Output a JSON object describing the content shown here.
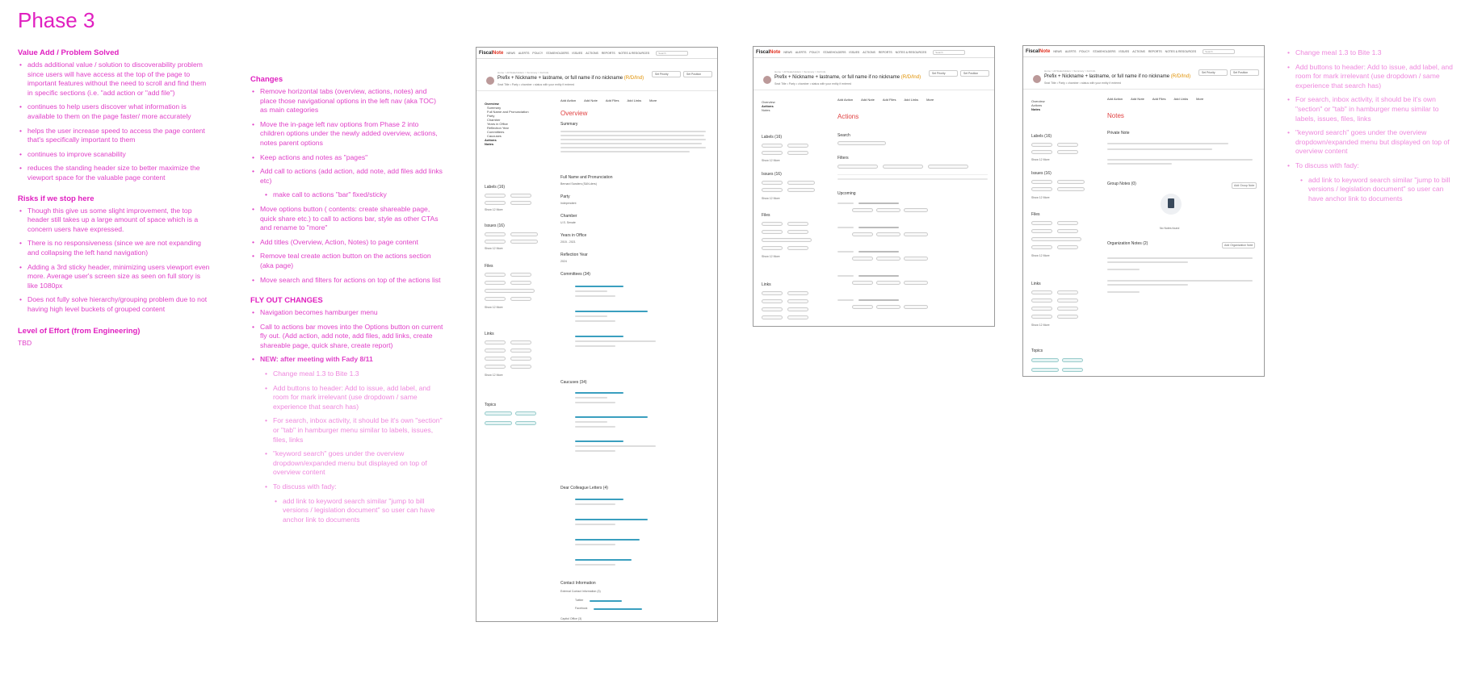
{
  "page_title": "Phase 3",
  "left_column": {
    "value_heading": "Value Add / Problem Solved",
    "value_items": [
      "adds additional value / solution to discoverability problem since users will have access at the top of the page to important features without the need to scroll and find them in specific sections (i.e. \"add action or \"add file\")",
      "continues to help users discover what information is available to them on the page faster/ more accurately",
      "helps the user increase speed to access the page content that's specifically important to them",
      "continues to improve scanability",
      "reduces the standing header size to better maximize the viewport space for the valuable page content"
    ],
    "risks_heading": "Risks if we stop here",
    "risk_items": [
      "Though this give us some slight improvement, the top header still takes up a large amount of space which is a concern users have expressed.",
      "There is no responsiveness (since we are not expanding and collapsing the left hand navigation)",
      "Adding a 3rd sticky header, minimizing users viewport even more. Average user's screen size as seen on full story is like 1080px",
      "Does not fully solve hierarchy/grouping problem due to not having high level buckets of grouped content"
    ],
    "effort_heading": "Level of Effort (from Engineering)",
    "effort_value": "TBD"
  },
  "changes_column": {
    "heading": "Changes",
    "items": [
      "Remove horizontal tabs (overview, actions, notes) and place those navigational options in the left nav (aka TOC) as main categories",
      "Move the in-page left nav options from Phase 2 into children options under the newly added overview, actions, notes parent options",
      "Keep actions and notes as \"pages\"",
      "Add call to actions (add action, add note, add files add links etc)"
    ],
    "sub_item": "make call to actions \"bar\" fixed/sticky",
    "items2": [
      "Move options button ( contents: create shareable page, quick share etc.) to call to actions bar, style as other CTAs and rename to \"more\"",
      "Add titles (Overview, Action, Notes) to page content",
      "Remove teal create action button on the actions section (aka page)",
      "Move search and filters for actions on top of the actions list"
    ],
    "flyout_heading": "FLY OUT CHANGES",
    "flyout_items": [
      "Navigation becomes hamburger menu",
      "Call to actions bar moves into the Options button on current fly out. (Add action, add note, add files, add links, create shareable page, quick share, create report)",
      "NEW: after meeting with Fady 8/11"
    ],
    "new_items": [
      "Change meal 1.3 to Bite 1.3",
      "Add buttons to header: Add to issue, add label, and room for mark irrelevant (use dropdown / same experience that search has)",
      "For search, inbox activity, it should be it's own \"section\" or \"tab\" in hamburger menu similar to labels, issues, files, links",
      "\"keyword search\" goes under the overview dropdown/expanded menu but displayed on top of overview content",
      "To discuss with fady:"
    ],
    "discuss_item": "add link to keyword search similar \"jump to bill versions / legislation document\" so user can have anchor link to documents"
  },
  "right_column": {
    "items": [
      "Change meal 1.3 to Bite 1.3",
      "Add buttons to header: Add to issue, add label, and room for mark irrelevant (use dropdown / same experience that search has)",
      "For search, inbox activity, it should be it's own \"section\" or \"tab\" in hamburger menu similar to labels, issues, files, links",
      "\"keyword search\" goes under the overview dropdown/expanded menu but displayed on top of overview content",
      "To discuss with fady:"
    ],
    "discuss_item": "add link to keyword search similar \"jump to bill versions / legislation document\" so user can have anchor link to documents"
  },
  "mock": {
    "logo_a": "Fiscal",
    "logo_b": "Note",
    "nav_items": [
      "NEWS",
      "ALERTS",
      "POLICY",
      "STAKEHOLDERS",
      "ISSUES",
      "ACTIONS",
      "REPORTS",
      "NOTES & RESOURCES"
    ],
    "search_placeholder": "Search",
    "breadcrumb": "Home > All Stakeholders > Summary > Full Info",
    "header_name": "Prefix + Nickname + lastname, or full name if no nickname",
    "header_party": "(R/D/Ind)",
    "header_sub": "Seat Title • Party • chamber • status with your entity if entered",
    "set_priority": "Set Priority",
    "set_position": "Set Position",
    "actions_bar": [
      "Add Action",
      "Add Note",
      "Add Files",
      "Add Links",
      "More"
    ],
    "toc_overview": [
      "Overview",
      "Summary",
      "Full Name and Pronunciation",
      "Party",
      "Chamber",
      "Years in Office",
      "Reflection Year",
      "Committees",
      "Caucuses",
      "Actions",
      "Notes"
    ],
    "toc_short": [
      "Overview",
      "Actions",
      "Notes"
    ],
    "labels_h": "Labels (16)",
    "issues_h": "Issues (16)",
    "files_h": "Files",
    "links_h": "Links",
    "topics_h": "Topics",
    "show_more": "Show 12 More",
    "overview_title": "Overview",
    "actions_title": "Actions",
    "notes_title": "Notes",
    "summary_h": "Summary",
    "fullname_h": "Full Name and Pronunciation",
    "fullname_v": "Bernard Sanders (SAN-ders)",
    "party_h": "Party",
    "party_v": "Independent",
    "chamber_h": "Chamber",
    "chamber_v": "U.S. Senate",
    "years_h": "Years in Office",
    "years_v": "2015 - 2021",
    "reelect_h": "Reflection Year",
    "reelect_v": "2024",
    "committees_h": "Committees (34)",
    "caucuses_h": "Caucuses (34)",
    "dcl_h": "Dear Colleague Letters (4)",
    "contact_h": "Contact Information",
    "contact_sub": "External Contact Information (3)",
    "twitter": "Twitter",
    "facebook": "Facebook",
    "capitol": "Capitol Office (3)",
    "search_h": "Search",
    "filters_h": "Filters",
    "upcoming_h": "Upcoming",
    "private_note_h": "Private Note",
    "group_notes_h": "Group Notes (0)",
    "add_group_note": "Add Group Note",
    "no_notes": "No Notes found",
    "org_notes_h": "Organization Notes (2)",
    "add_org_note": "Add Organization Note"
  }
}
